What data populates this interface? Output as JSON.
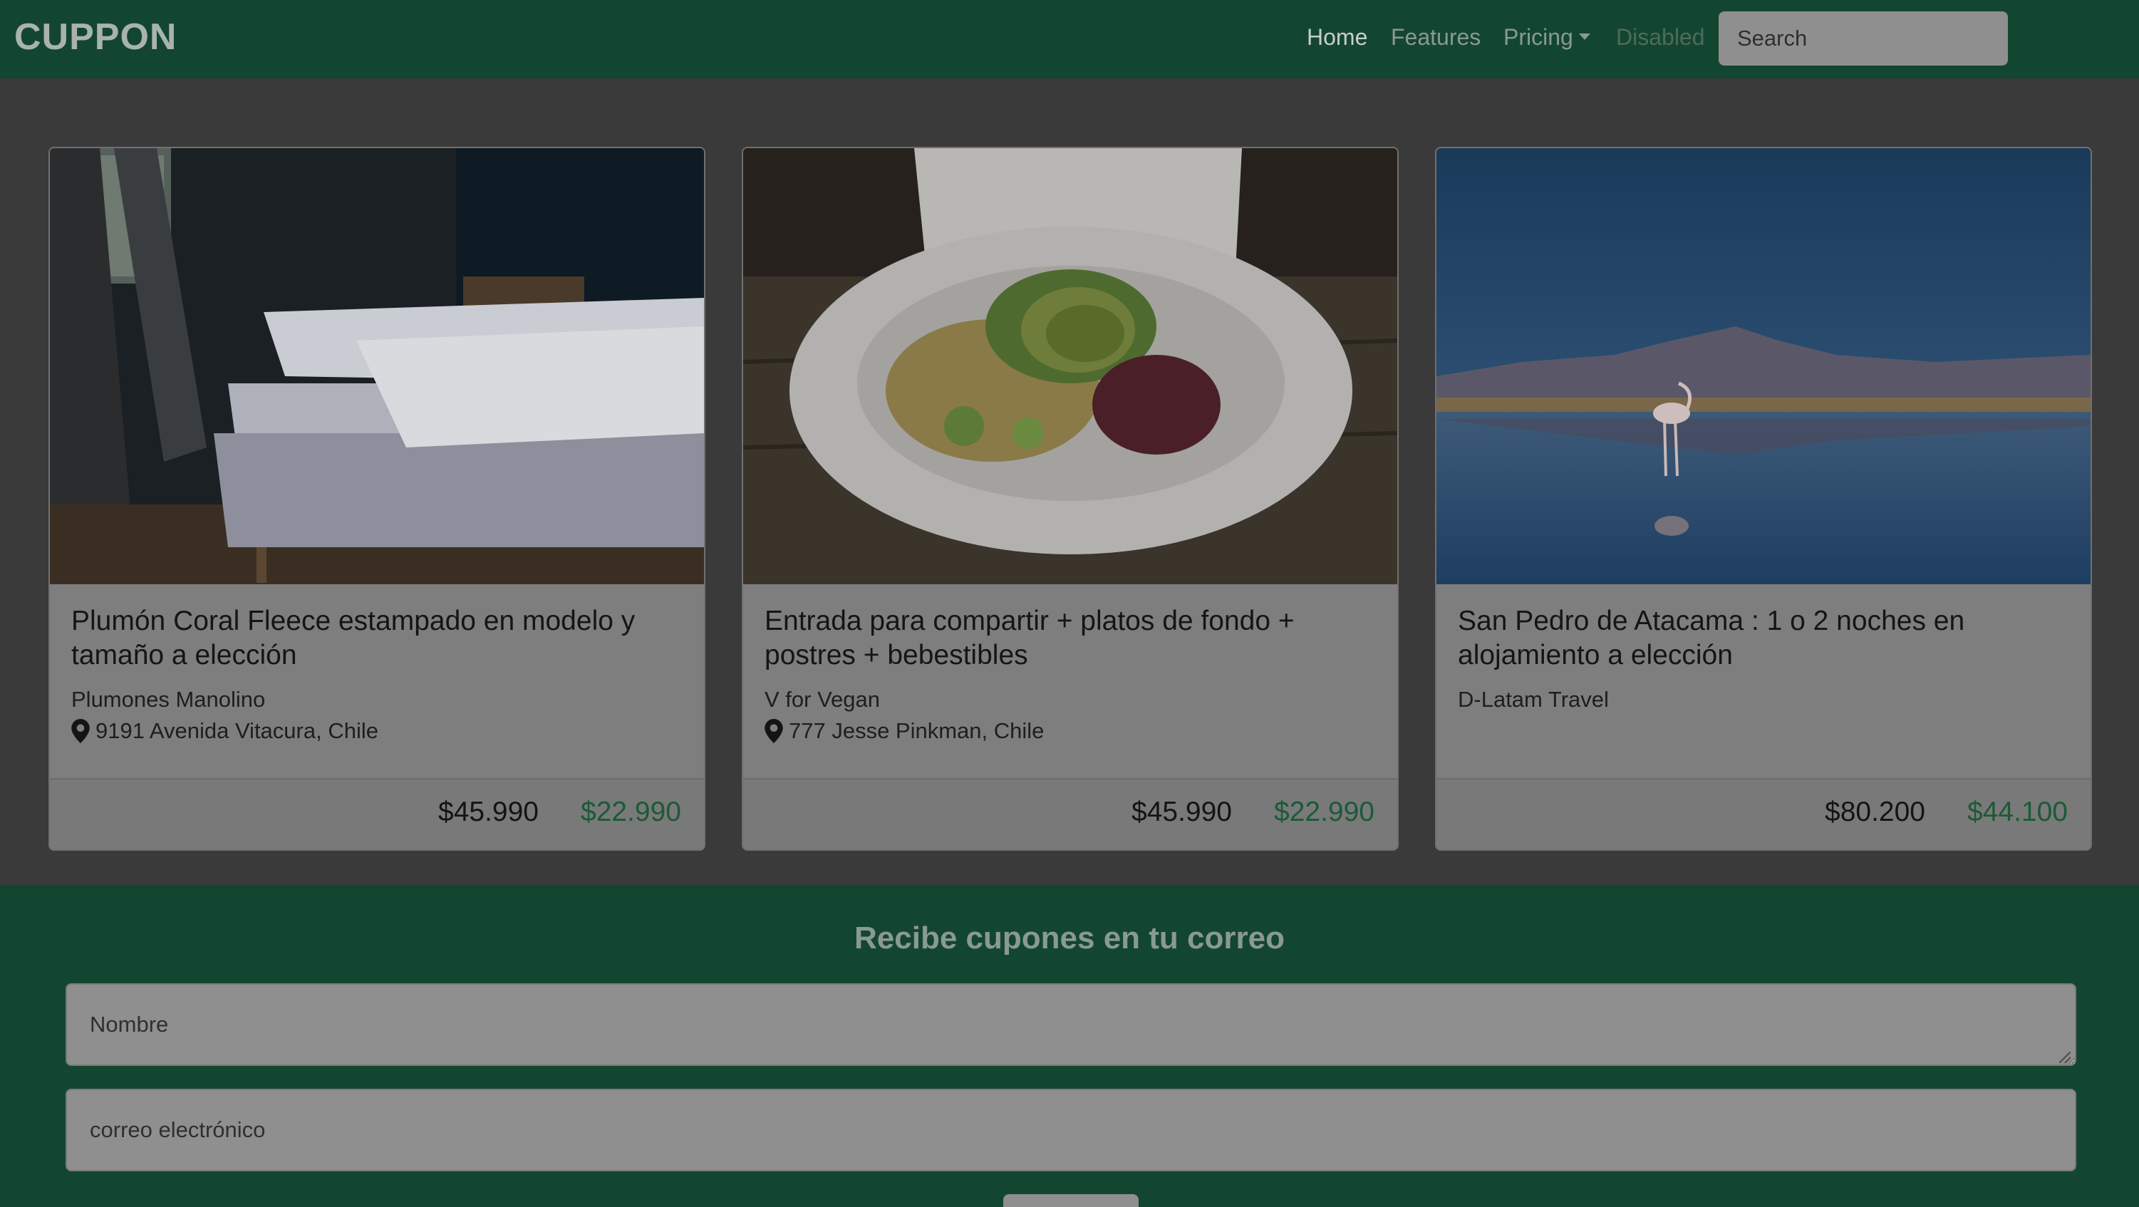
{
  "navbar": {
    "brand": "CUPPON",
    "links": {
      "home": "Home",
      "features": "Features",
      "pricing": "Pricing",
      "disabled": "Disabled"
    },
    "search_placeholder": "Search"
  },
  "cards": [
    {
      "title": "Plumón Coral Fleece estampado en modelo y tamaño a elección",
      "vendor": "Plumones Manolino",
      "address": "9191 Avenida Vitacura, Chile",
      "price_old": "$45.990",
      "price_new": "$22.990"
    },
    {
      "title": "Entrada para compartir + platos de fondo + postres + bebestibles",
      "vendor": "V for Vegan",
      "address": "777 Jesse Pinkman, Chile",
      "price_old": "$45.990",
      "price_new": "$22.990"
    },
    {
      "title": "San Pedro de Atacama : 1 o 2 noches en alojamiento a elección",
      "vendor": "D-Latam Travel",
      "price_old": "$80.200",
      "price_new": "$44.100"
    }
  ],
  "subscribe": {
    "title": "Recibe cupones en tu correo",
    "name_placeholder": "Nombre",
    "email_placeholder": "correo electrónico"
  },
  "colors": {
    "navbar_bg": "#134630",
    "price_accent": "#1b5a37",
    "overlay": "#3a3a3a"
  },
  "icons": [
    "map-pin-icon",
    "caret-down-icon",
    "resize-grip-icon"
  ]
}
